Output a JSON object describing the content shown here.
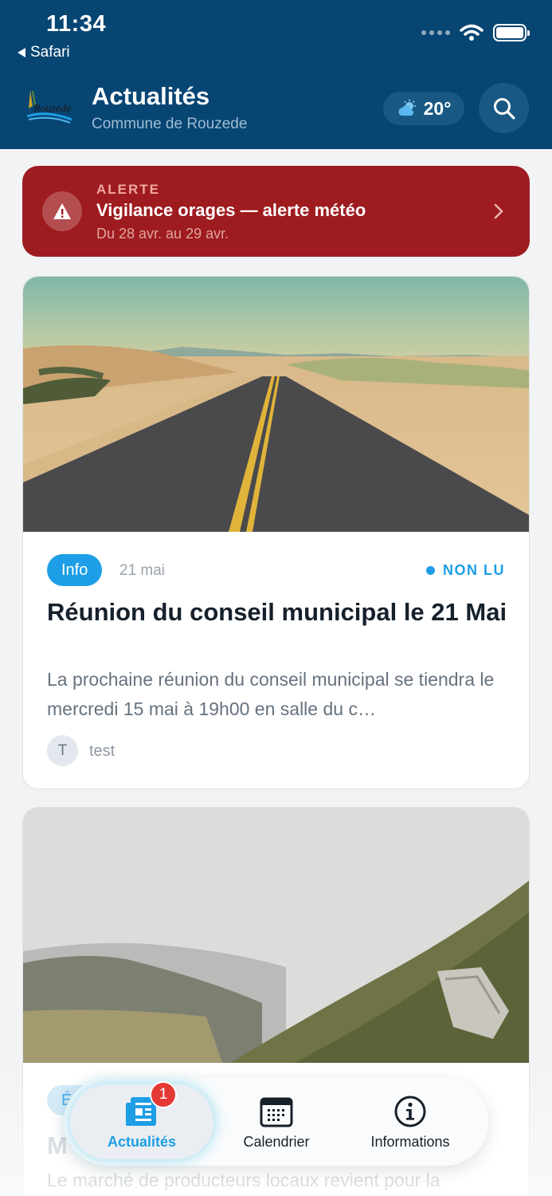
{
  "status_bar": {
    "time": "11:34",
    "back_label": "Safari"
  },
  "header": {
    "title": "Actualités",
    "subtitle": "Commune de Rouzede",
    "logo_text": "Rouzede",
    "weather": {
      "icon": "partly-cloudy-icon",
      "temperature": "20°"
    },
    "search_icon": "search-icon"
  },
  "alert": {
    "kicker": "ALERTE",
    "title": "Vigilance orages — alerte météo",
    "dates": "Du 28 avr. au 29 avr.",
    "color": "#9e1b1f"
  },
  "posts": [
    {
      "category": "Info",
      "date": "21 mai",
      "status": "NON LU",
      "title": "Réunion du conseil municipal le 21 Mai",
      "excerpt": "La prochaine réunion du conseil municipal se tiendra le mercredi 15 mai à 19h00 en salle du c…",
      "author_initial": "T",
      "author": "test",
      "image": "desert-road-photo"
    },
    {
      "category": "É",
      "title": "M",
      "excerpt": "Le marché de producteurs locaux revient pour la",
      "image": "misty-hills-photo"
    }
  ],
  "tabbar": {
    "tabs": [
      {
        "label": "Actualités",
        "icon": "newspaper-icon",
        "badge": "1",
        "active": true
      },
      {
        "label": "Calendrier",
        "icon": "calendar-icon"
      },
      {
        "label": "Informations",
        "icon": "info-icon"
      }
    ]
  },
  "colors": {
    "header": "#074573",
    "accent": "#1d9ee6",
    "badge": "#e53935"
  }
}
